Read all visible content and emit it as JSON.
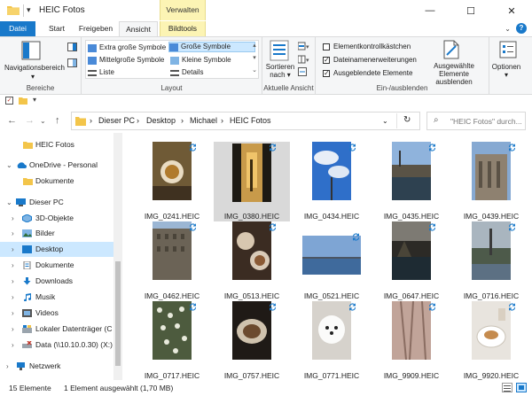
{
  "window": {
    "title": "HEIC Fotos",
    "context_tab": "Verwalten",
    "minimize": "—",
    "maximize": "☐",
    "close": "✕"
  },
  "tabs": {
    "file": "Datei",
    "start": "Start",
    "share": "Freigeben",
    "view": "Ansicht",
    "picture_tools": "Bildtools"
  },
  "ribbon": {
    "panes": {
      "nav_pane": "Navigationsbereich",
      "group_label": "Bereiche"
    },
    "layout": {
      "items": [
        "Extra große Symbole",
        "Große Symbole",
        "Mittelgroße Symbole",
        "Kleine Symbole",
        "Liste",
        "Details"
      ],
      "group_label": "Layout"
    },
    "current_view": {
      "sort": "Sortieren nach",
      "sort_line1": "Sortieren",
      "sort_line2": "nach",
      "group_label": "Aktuelle Ansicht"
    },
    "show_hide": {
      "item_checkboxes": "Elementkontrollkästchen",
      "file_extensions": "Dateinamenerweiterungen",
      "hidden_items": "Ausgeblendete Elemente",
      "hide_selected_line1": "Ausgewählte",
      "hide_selected_line2": "Elemente ausblenden",
      "group_label": "Ein-/ausblenden"
    },
    "options": "Optionen"
  },
  "address": {
    "crumbs": [
      "Dieser PC",
      "Desktop",
      "Michael",
      "HEIC Fotos"
    ],
    "search_placeholder": "\"HEIC Fotos\" durch..."
  },
  "sidebar": {
    "items": [
      {
        "label": "HEIC Fotos"
      },
      {
        "label": "OneDrive - Personal"
      },
      {
        "label": "Dokumente"
      },
      {
        "label": "Dieser PC"
      },
      {
        "label": "3D-Objekte"
      },
      {
        "label": "Bilder"
      },
      {
        "label": "Desktop"
      },
      {
        "label": "Dokumente"
      },
      {
        "label": "Downloads"
      },
      {
        "label": "Musik"
      },
      {
        "label": "Videos"
      },
      {
        "label": "Lokaler Datenträger (C"
      },
      {
        "label": "Data (\\\\10.10.0.30) (X:)"
      },
      {
        "label": "Netzwerk"
      }
    ]
  },
  "files": [
    {
      "name": "IMG_0241.HEIC"
    },
    {
      "name": "IMG_0380.HEIC"
    },
    {
      "name": "IMG_0434.HEIC"
    },
    {
      "name": "IMG_0435.HEIC"
    },
    {
      "name": "IMG_0439.HEIC"
    },
    {
      "name": "IMG_0462.HEIC"
    },
    {
      "name": "IMG_0513.HEIC"
    },
    {
      "name": "IMG_0521.HEIC"
    },
    {
      "name": "IMG_0647.HEIC"
    },
    {
      "name": "IMG_0716.HEIC"
    },
    {
      "name": "IMG_0717.HEIC"
    },
    {
      "name": "IMG_0757.HEIC"
    },
    {
      "name": "IMG_0771.HEIC"
    },
    {
      "name": "IMG_9909.HEIC"
    },
    {
      "name": "IMG_9920.HEIC"
    }
  ],
  "status": {
    "count": "15 Elemente",
    "selection": "1 Element ausgewählt (1,70 MB)"
  },
  "colors": {
    "accent": "#1979ca",
    "selection": "#cce8ff",
    "context_tab": "#fcf4b4",
    "folder": "#f3c54a"
  }
}
